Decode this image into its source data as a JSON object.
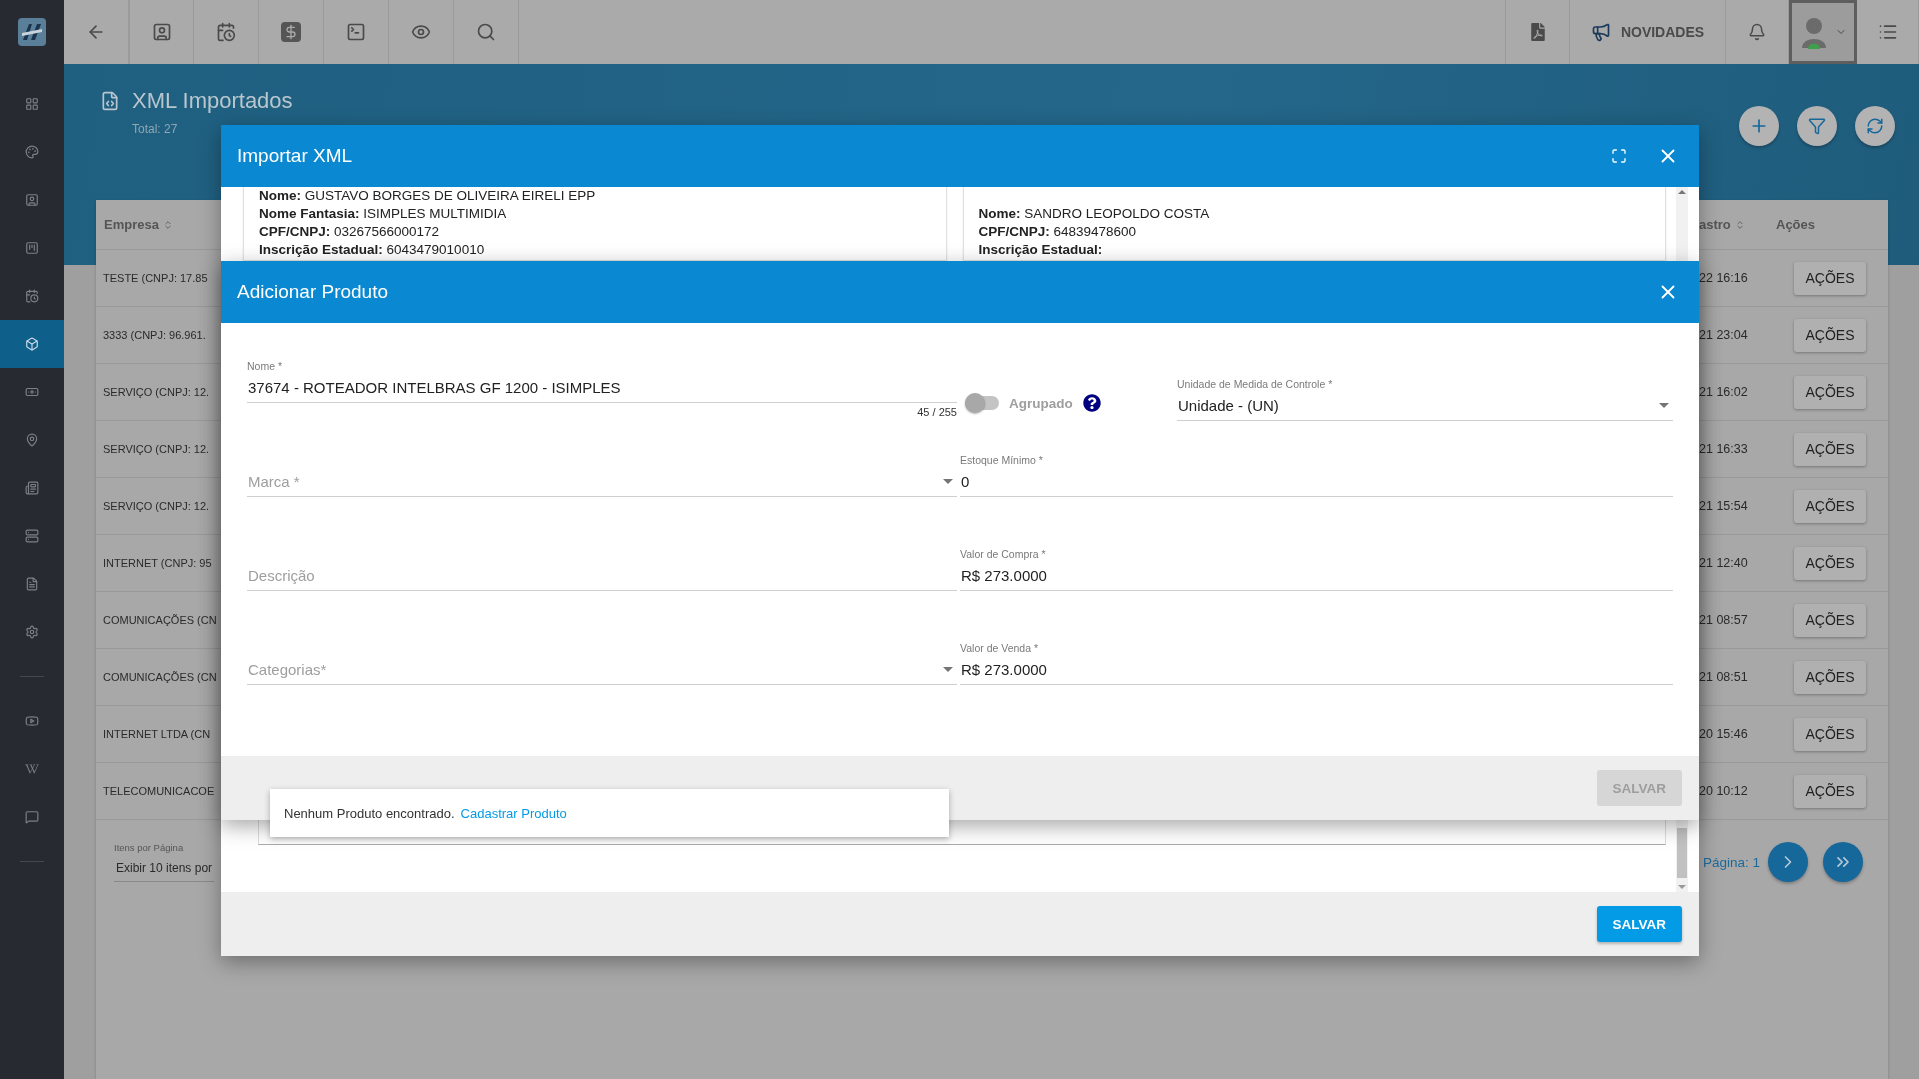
{
  "topbar": {
    "news_label": "NOVIDADES"
  },
  "sidebar": {
    "items": [
      {
        "selected": false
      },
      {
        "selected": false
      },
      {
        "selected": false
      },
      {
        "selected": false
      },
      {
        "selected": false
      },
      {
        "selected": true
      },
      {
        "selected": false
      },
      {
        "selected": false
      },
      {
        "selected": false
      },
      {
        "selected": false
      },
      {
        "selected": false
      },
      {
        "selected": false
      },
      {
        "selected": false
      },
      {
        "selected": false
      },
      {
        "selected": false
      }
    ]
  },
  "page": {
    "title": "XML Importados",
    "total": "Total: 27"
  },
  "table": {
    "columns": [
      "Empresa",
      "astro",
      "Ações"
    ],
    "rows": [
      {
        "company": "TESTE (CNPJ: 17.85",
        "date": "22 16:16",
        "action": "AÇÕES"
      },
      {
        "company": "3333 (CNPJ: 96.961.",
        "date": "21 23:04",
        "action": "AÇÕES"
      },
      {
        "company": "SERVIÇO (CNPJ: 12.",
        "date": "21 16:02",
        "action": "AÇÕES"
      },
      {
        "company": "SERVIÇO (CNPJ: 12.",
        "date": "21 16:33",
        "action": "AÇÕES"
      },
      {
        "company": "SERVIÇO (CNPJ: 12.",
        "date": "21 15:54",
        "action": "AÇÕES"
      },
      {
        "company": "INTERNET (CNPJ: 95",
        "date": "21 12:40",
        "action": "AÇÕES"
      },
      {
        "company": "COMUNICAÇÕES (CN",
        "date": "21 08:57",
        "action": "AÇÕES"
      },
      {
        "company": "COMUNICAÇÕES (CN",
        "date": "21 08:51",
        "action": "AÇÕES"
      },
      {
        "company": "INTERNET LTDA (CN",
        "date": "20 15:46",
        "action": "AÇÕES"
      },
      {
        "company": "TELECOMUNICACOE",
        "date": "20 10:12",
        "action": "AÇÕES"
      }
    ]
  },
  "pagination": {
    "items_label": "Itens por Página",
    "items_value": "Exibir 10 itens por",
    "page": "Página: 1"
  },
  "import_modal": {
    "title": "Importar XML",
    "issuer": [
      "**Nome:** GUSTAVO BORGES DE OLIVEIRA EIRELI EPP",
      "**Nome Fantasia:** ISIMPLES MULTIMIDIA",
      "**CPF/CNPJ:** 03267566000172",
      "**Inscrição Estadual:** 6043479010010"
    ],
    "recipient": [
      "**Nome:** SANDRO LEOPOLDO COSTA",
      "**CPF/CNPJ:** 64839478600",
      "**Inscrição Estadual:**"
    ],
    "save": "SALVAR"
  },
  "product_modal": {
    "title": "Adicionar Produto",
    "nome": {
      "label": "Nome *",
      "value": "37674 - ROTEADOR INTELBRAS GF 1200 - ISIMPLES",
      "counter": "45 / 255"
    },
    "agrupado": {
      "label": "Agrupado",
      "on": false
    },
    "unidade": {
      "label": "Unidade de Medida de Controle *",
      "value": "Unidade - (UN)"
    },
    "marca": {
      "placeholder": "Marca *"
    },
    "estoque_minimo": {
      "label": "Estoque Mínimo *",
      "value": "0"
    },
    "descricao": {
      "placeholder": "Descrição"
    },
    "valor_compra": {
      "label": "Valor de Compra *",
      "value": "R$ 273.0000"
    },
    "categorias": {
      "placeholder": "Categorias*"
    },
    "valor_venda": {
      "label": "Valor de Venda *",
      "value": "R$ 273.0000"
    },
    "save": {
      "label": "SALVAR",
      "disabled": true
    }
  },
  "dropdown": {
    "message": "Nenhum Produto encontrado.",
    "link": "Cadastrar Produto"
  }
}
